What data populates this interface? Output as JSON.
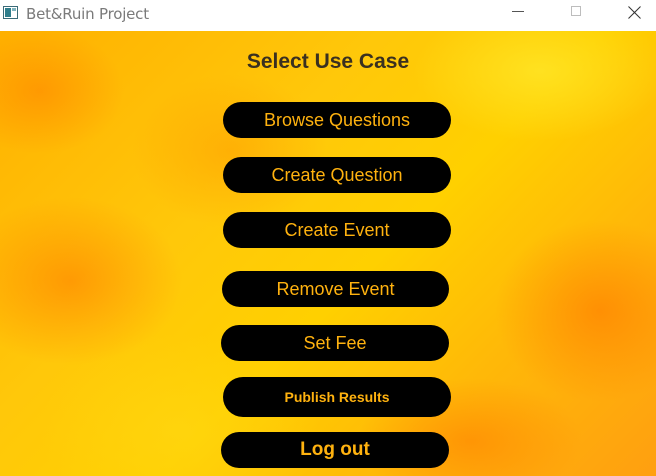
{
  "window": {
    "title": "Bet&Ruin Project",
    "controls": {
      "minimize": "minimize-icon",
      "maximize": "maximize-icon",
      "close": "close-icon"
    }
  },
  "main": {
    "heading": "Select Use Case",
    "buttons": [
      {
        "label": "Browse Questions"
      },
      {
        "label": "Create Question"
      },
      {
        "label": "Create Event"
      },
      {
        "label": "Remove Event"
      },
      {
        "label": "Set Fee"
      },
      {
        "label": "Publish Results"
      },
      {
        "label": "Log out"
      }
    ]
  },
  "colors": {
    "button_bg": "#000000",
    "button_text": "#ffb20f",
    "heading_text": "#3a3020"
  }
}
